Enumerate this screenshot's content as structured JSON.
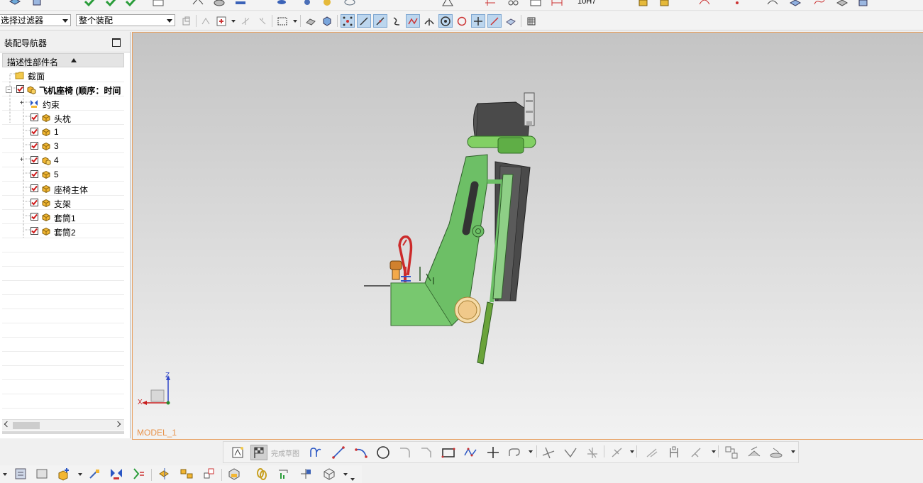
{
  "toolbar": {
    "selection_filter": "选择过滤器",
    "assembly_scope": "整个装配",
    "scale_readout": "10H7"
  },
  "navigator": {
    "title": "装配导航器",
    "column_header": "描述性部件名",
    "items": [
      {
        "label": "截面",
        "level": 0,
        "checked": false,
        "icon": "folder-icon"
      },
      {
        "label": "飞机座椅 (顺序：时间",
        "level": 0,
        "checked": true,
        "icon": "assembly-icon",
        "expanded": true
      },
      {
        "label": "约束",
        "level": 1,
        "checked": false,
        "icon": "constraint-icon",
        "expandable": true
      },
      {
        "label": "头枕",
        "level": 1,
        "checked": true,
        "icon": "part-icon"
      },
      {
        "label": "1",
        "level": 1,
        "checked": true,
        "icon": "part-icon"
      },
      {
        "label": "3",
        "level": 1,
        "checked": true,
        "icon": "part-icon"
      },
      {
        "label": "4",
        "level": 1,
        "checked": true,
        "icon": "assembly-icon",
        "expandable": true
      },
      {
        "label": "5",
        "level": 1,
        "checked": true,
        "icon": "part-icon"
      },
      {
        "label": "座椅主体",
        "level": 1,
        "checked": true,
        "icon": "part-icon"
      },
      {
        "label": "支架",
        "level": 1,
        "checked": true,
        "icon": "part-icon"
      },
      {
        "label": "套筒1",
        "level": 1,
        "checked": true,
        "icon": "part-icon"
      },
      {
        "label": "套筒2",
        "level": 1,
        "checked": true,
        "icon": "part-icon"
      }
    ]
  },
  "viewport": {
    "model_name": "MODEL_1",
    "triad": {
      "z": "Z",
      "x": "X"
    }
  },
  "sketch_toolbar": {
    "finish_sketch": "完成草图"
  },
  "colors": {
    "model_green": "#6dbf66",
    "model_dark": "#4a4a4a",
    "handle_red": "#cc2a2a",
    "accent_orange": "#e8924a",
    "highlight_blue": "#bcd6ee"
  }
}
